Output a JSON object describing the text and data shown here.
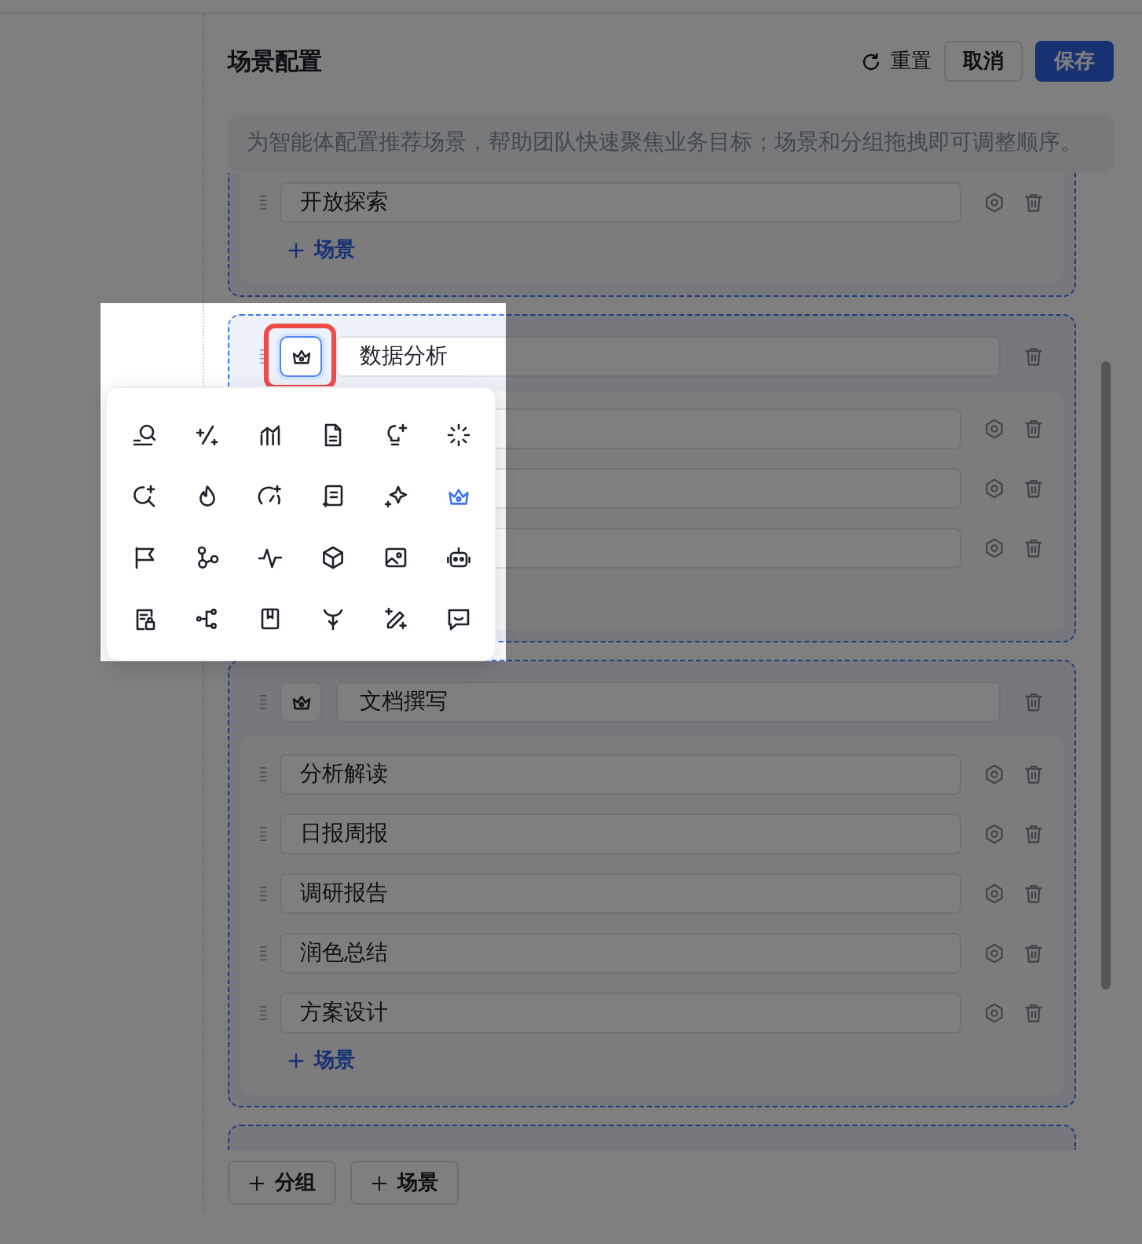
{
  "header": {
    "title": "场景配置",
    "actions": [
      {
        "kind": "reset",
        "label": "重置"
      },
      {
        "kind": "secondary",
        "label": "取消"
      },
      {
        "kind": "primary",
        "label": "保存"
      }
    ]
  },
  "notice": "为智能体配置推荐场景，帮助团队快速聚焦业务目标；场景和分组拖拽即可调整顺序。",
  "groups": [
    {
      "kind": "clipped_top",
      "scenes": [
        {
          "kind": "scene",
          "name": "开放探索"
        }
      ],
      "add_label": "场景"
    },
    {
      "kind": "full",
      "name": "数据分析",
      "picker_open": true,
      "scenes": [
        {
          "kind": "scene"
        },
        {
          "kind": "scene"
        },
        {
          "kind": "scene"
        }
      ]
    },
    {
      "kind": "full",
      "name": "文档撰写",
      "picker_open": false,
      "scenes": [
        {
          "kind": "scene",
          "name": "分析解读"
        },
        {
          "kind": "scene",
          "name": "日报周报"
        },
        {
          "kind": "scene",
          "name": "调研报告"
        },
        {
          "kind": "scene",
          "name": "润色总结"
        },
        {
          "kind": "scene",
          "name": "方案设计"
        }
      ],
      "add_label": "场景"
    },
    {
      "kind": "clipped_bottom"
    }
  ],
  "icon_picker": {
    "icons": [
      {
        "selected": false
      },
      {
        "selected": false
      },
      {
        "selected": false
      },
      {
        "selected": false
      },
      {
        "selected": false
      },
      {
        "selected": false
      },
      {
        "selected": false
      },
      {
        "selected": false
      },
      {
        "selected": false
      },
      {
        "selected": false
      },
      {
        "selected": false
      },
      {
        "selected": true
      },
      {
        "selected": false
      },
      {
        "selected": false
      },
      {
        "selected": false
      },
      {
        "selected": false
      },
      {
        "selected": false
      },
      {
        "selected": false
      },
      {
        "selected": false
      },
      {
        "selected": false
      },
      {
        "selected": false
      },
      {
        "selected": false
      },
      {
        "selected": false
      },
      {
        "selected": false
      }
    ]
  },
  "onboarding": {
    "spotlight": true
  },
  "footer": {
    "buttons": [
      {
        "label": "分组"
      },
      {
        "label": "场景"
      }
    ]
  }
}
